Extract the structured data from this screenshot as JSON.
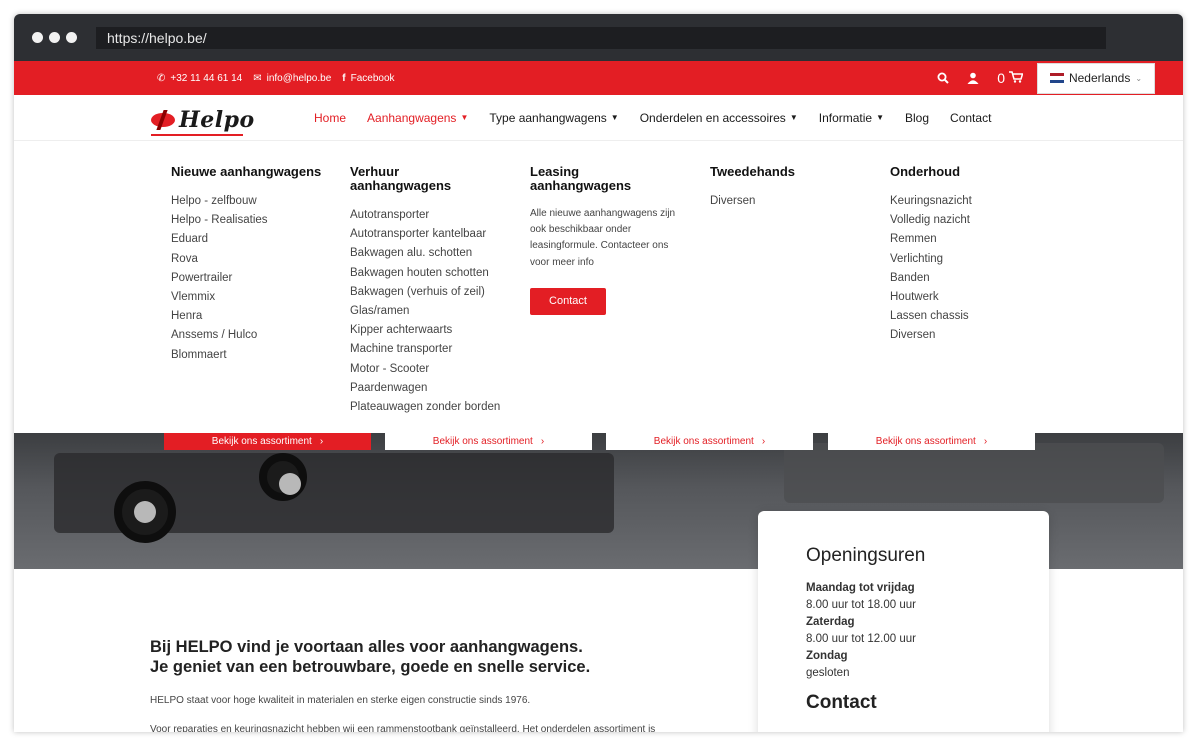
{
  "browser": {
    "url": "https://helpo.be/"
  },
  "topbar": {
    "phone": "+32 11 44 61 14",
    "email": "info@helpo.be",
    "facebook": "Facebook",
    "cart_count": "0",
    "language": "Nederlands",
    "accent_color": "#e31e24"
  },
  "logo": {
    "text": "Helpo"
  },
  "nav": {
    "items": [
      {
        "label": "Home",
        "dropdown": false
      },
      {
        "label": "Aanhangwagens",
        "dropdown": true
      },
      {
        "label": "Type aanhangwagens",
        "dropdown": true
      },
      {
        "label": "Onderdelen en accessoires",
        "dropdown": true
      },
      {
        "label": "Informatie",
        "dropdown": true
      },
      {
        "label": "Blog",
        "dropdown": false
      },
      {
        "label": "Contact",
        "dropdown": false
      }
    ]
  },
  "megamenu": {
    "col1": {
      "heading": "Nieuwe aanhangwagens",
      "links": [
        "Helpo - zelfbouw",
        "Helpo - Realisaties",
        "Eduard",
        "Rova",
        "Powertrailer",
        "Vlemmix",
        "Henra",
        "Anssems / Hulco",
        "Blommaert"
      ]
    },
    "col2": {
      "heading": "Verhuur aanhangwagens",
      "links": [
        "Autotransporter",
        "Autotransporter kantelbaar",
        "Bakwagen alu. schotten",
        "Bakwagen houten schotten",
        "Bakwagen (verhuis of zeil)",
        "Glas/ramen",
        "Kipper achterwaarts",
        "Machine transporter",
        "Motor - Scooter",
        "Paardenwagen",
        "Plateauwagen zonder borden"
      ]
    },
    "col3": {
      "heading": "Leasing aanhangwagens",
      "text": "Alle nieuwe aanhangwagens zijn ook beschikbaar onder leasingformule. Contacteer ons voor meer info",
      "button": "Contact"
    },
    "col4": {
      "heading": "Tweedehands",
      "links": [
        "Diversen"
      ]
    },
    "col5": {
      "heading": "Onderhoud",
      "links": [
        "Keuringsnazicht",
        "Volledig nazicht",
        "Remmen",
        "Verlichting",
        "Banden",
        "Houtwerk",
        "Lassen chassis",
        "Diversen"
      ]
    }
  },
  "hero": {
    "buttons": [
      "Bekijk ons assortiment",
      "Bekijk ons assortiment",
      "Bekijk ons assortiment",
      "Bekijk ons assortiment"
    ]
  },
  "content": {
    "headline_1": "Bij HELPO vind je voortaan alles voor aanhangwagens.",
    "headline_2": "Je geniet van een betrouwbare, goede en snelle service.",
    "paragraph": "HELPO staat voor hoge kwaliteit in materialen en sterke eigen constructie sinds 1976.",
    "paragraph_2": "Voor reparaties en keuringsnazicht hebben wij een rammenstootbank geïnstalleerd. Het onderdelen assortiment is"
  },
  "hours": {
    "title": "Openingsuren",
    "rows": [
      {
        "day": "Maandag tot vrijdag",
        "time": "8.00 uur tot 18.00 uur"
      },
      {
        "day": "Zaterdag",
        "time": "8.00 uur tot 12.00 uur"
      },
      {
        "day": "Zondag",
        "time": "gesloten"
      }
    ],
    "contact_title": "Contact"
  }
}
